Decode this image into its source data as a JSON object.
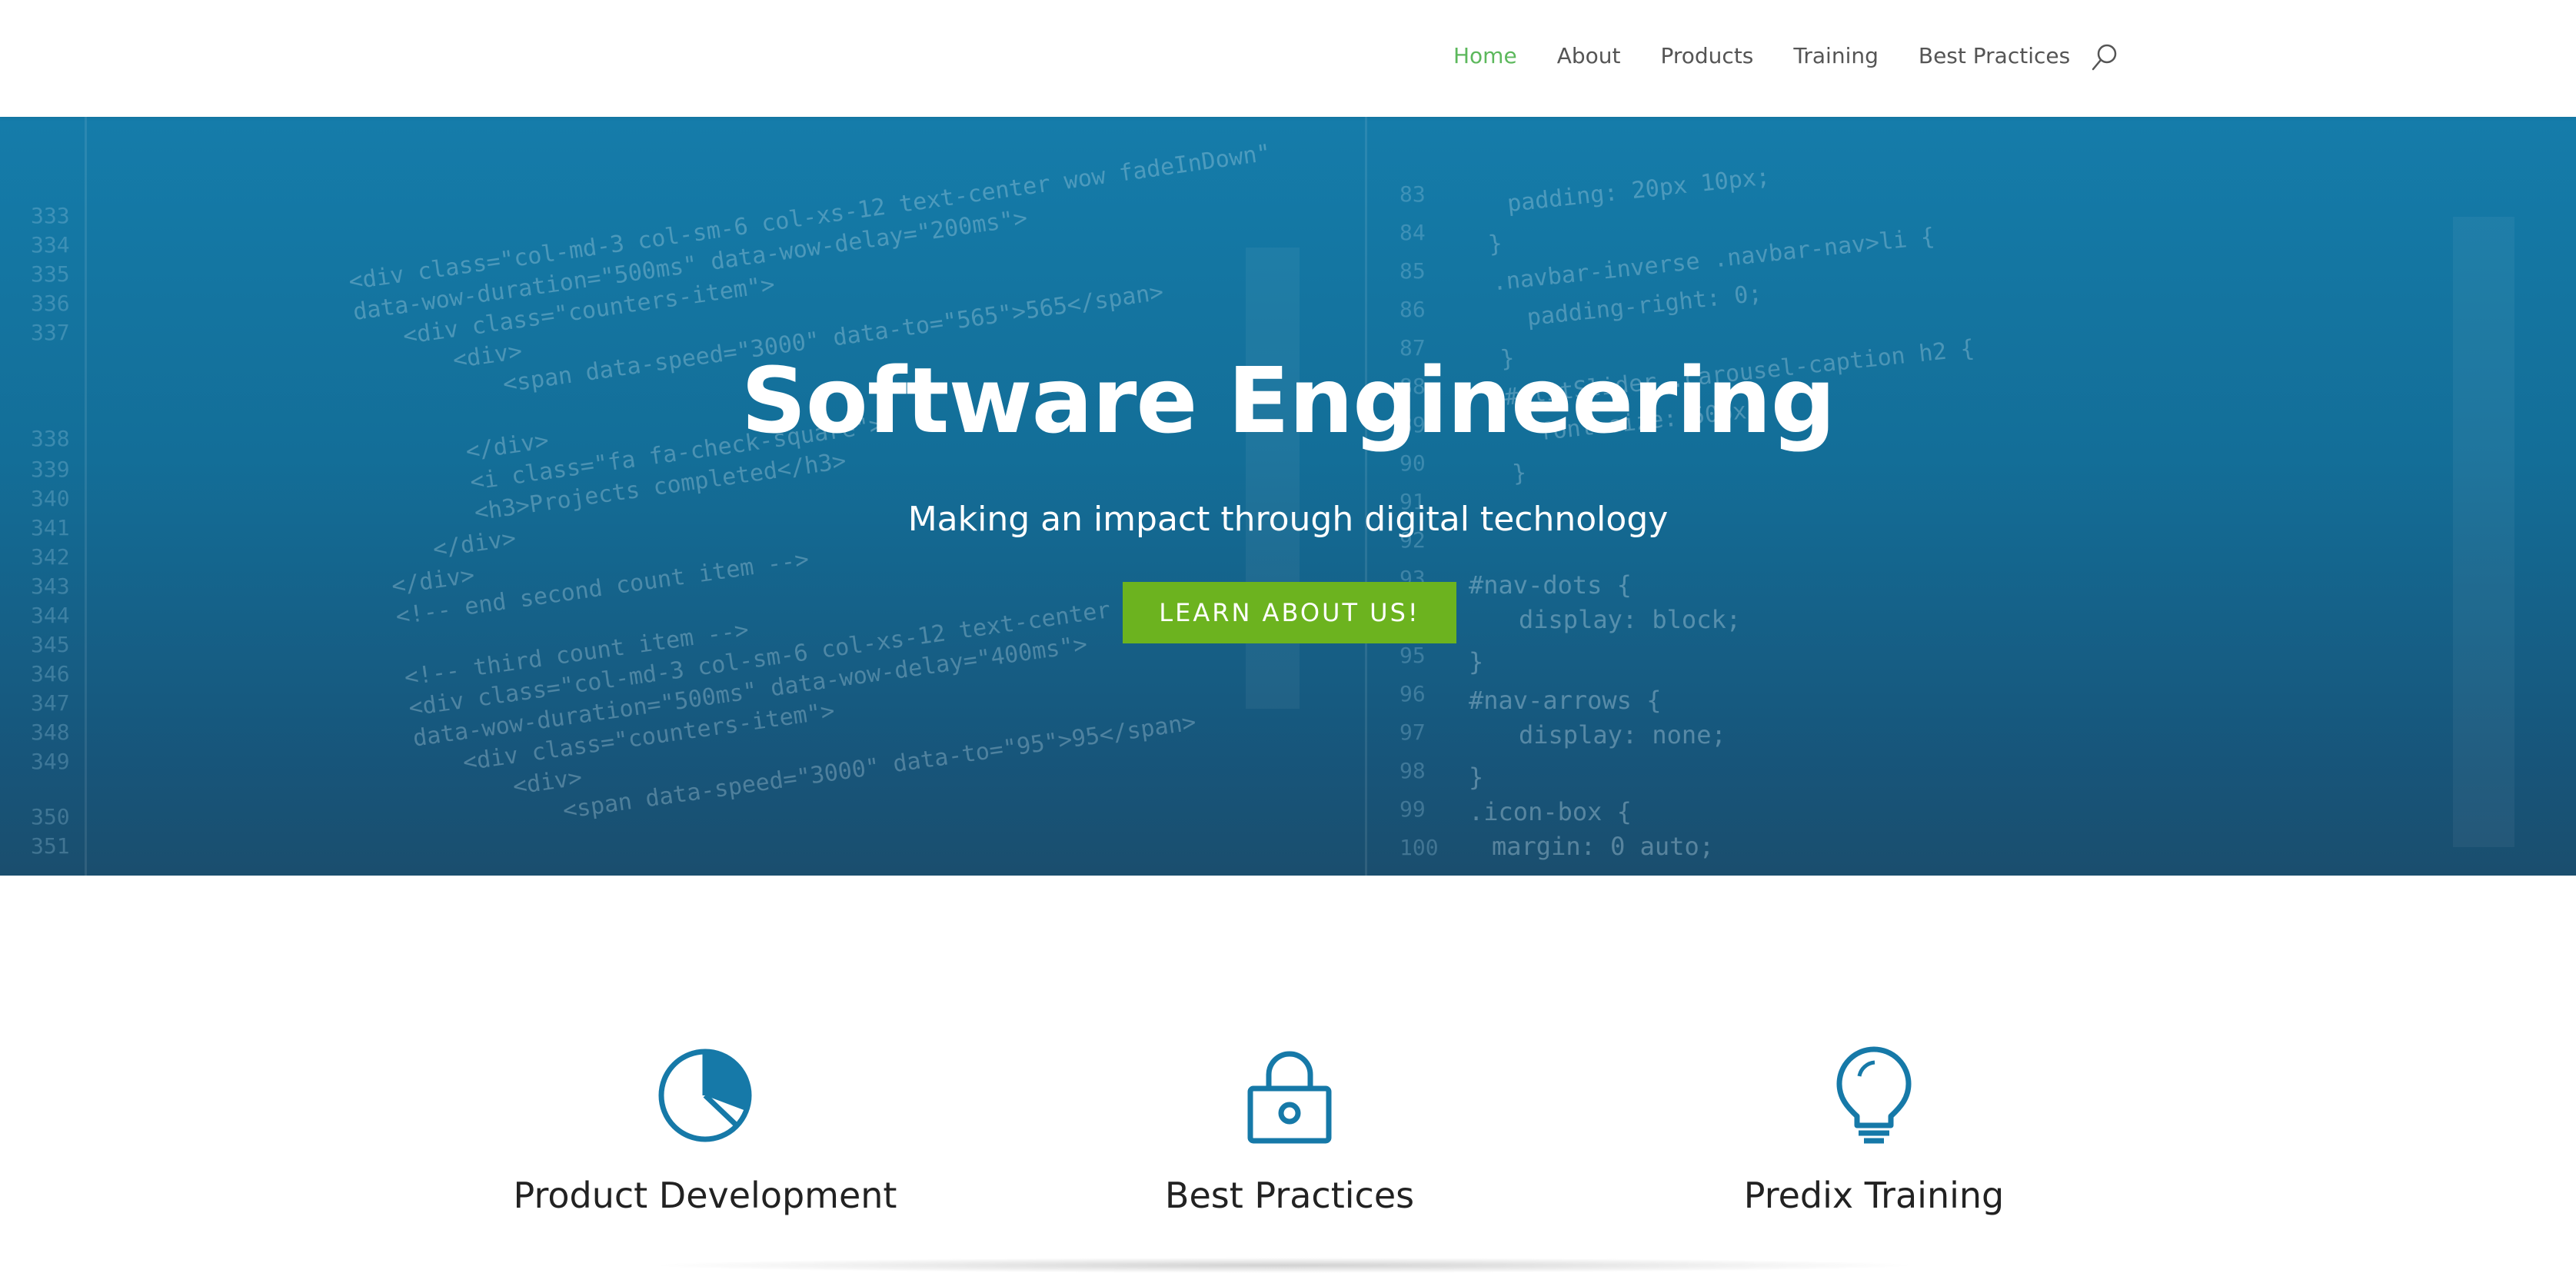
{
  "nav": {
    "items": [
      {
        "label": "Home",
        "active": true
      },
      {
        "label": "About",
        "active": false
      },
      {
        "label": "Products",
        "active": false
      },
      {
        "label": "Training",
        "active": false
      },
      {
        "label": "Best Practices",
        "active": false
      }
    ],
    "search_icon": "search-icon",
    "active_color": "#5cb85c"
  },
  "hero": {
    "title": "Software Engineering",
    "subtitle": "Making an impact through digital technology",
    "button_label": "LEARN ABOUT US!",
    "button_color": "#6cb31f",
    "background_color": "#157caa"
  },
  "features": [
    {
      "title": "Product Development",
      "icon": "pie-chart-icon"
    },
    {
      "title": "Best Practices",
      "icon": "lock-icon"
    },
    {
      "title": "Predix Training",
      "icon": "lightbulb-icon"
    }
  ],
  "accent_color": "#1679a8"
}
